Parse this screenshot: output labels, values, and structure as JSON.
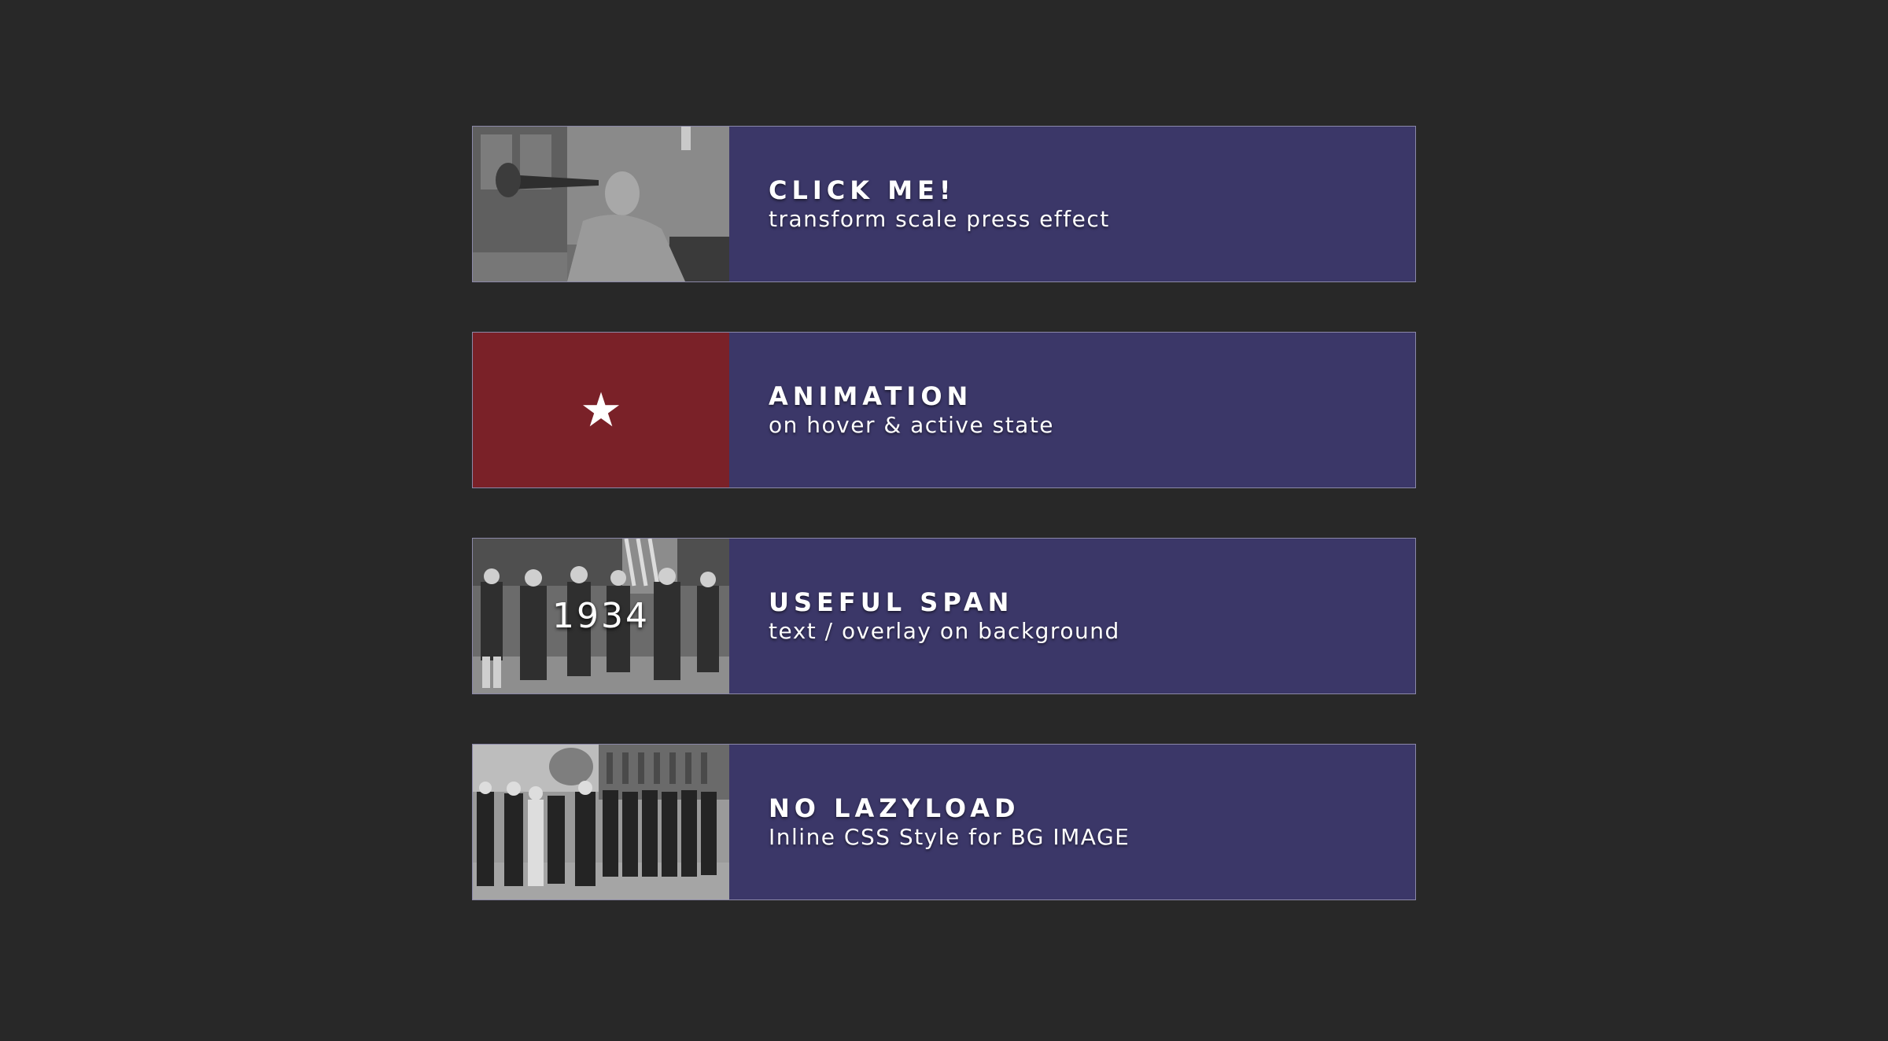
{
  "cards": [
    {
      "title": "CLICK ME!",
      "subtitle": "transform scale press effect",
      "thumb_icon": "photo-trumpeter",
      "overlay": ""
    },
    {
      "title": "ANIMATION",
      "subtitle": "on hover & active state",
      "thumb_icon": "star-icon",
      "thumb_color": "#7a2128",
      "overlay": "★"
    },
    {
      "title": "USEFUL SPAN",
      "subtitle": "text / overlay on background",
      "thumb_icon": "photo-parade",
      "overlay": "1934"
    },
    {
      "title": "NO LAZYLOAD",
      "subtitle": "Inline CSS Style for BG IMAGE",
      "thumb_icon": "photo-march",
      "overlay": ""
    }
  ],
  "colors": {
    "background": "#282828",
    "card": "#3b3768",
    "border": "#8b88a8",
    "accent_red": "#7a2128"
  }
}
